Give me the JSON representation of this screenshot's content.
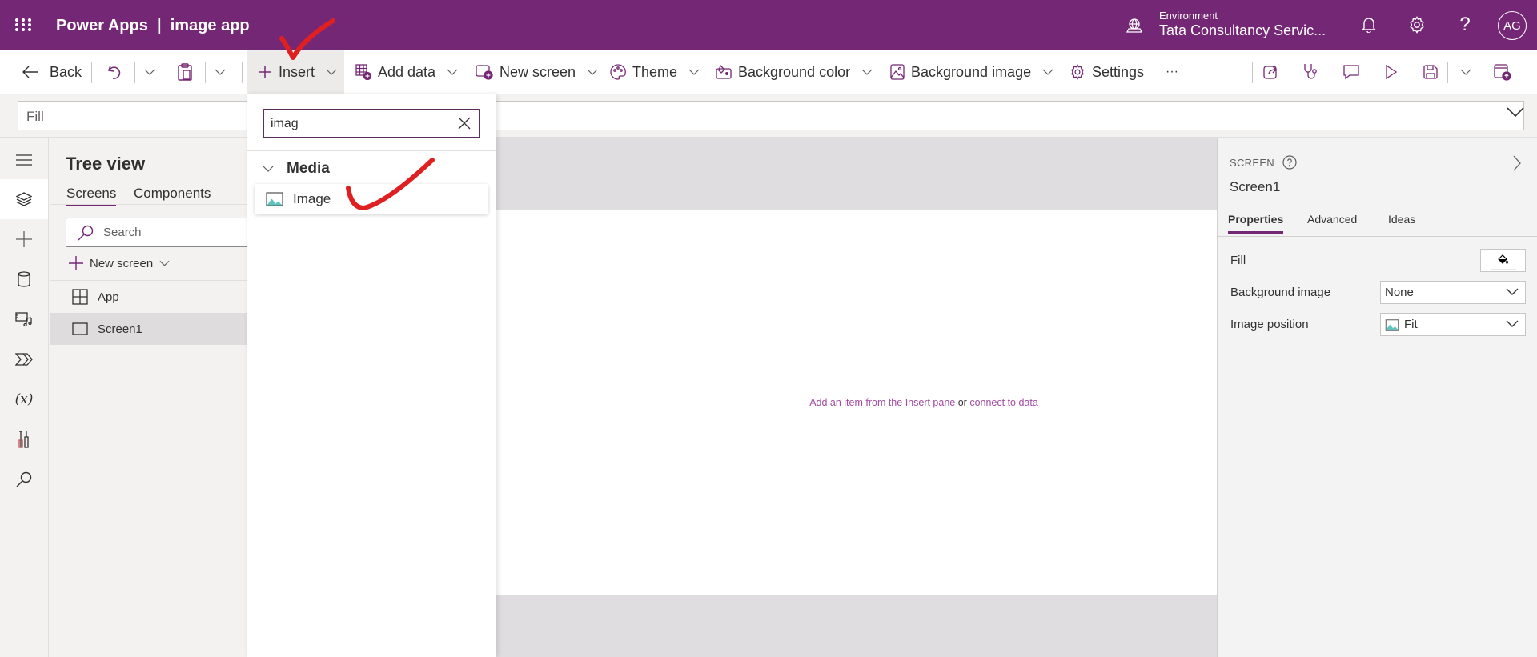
{
  "header": {
    "app_name": "Power Apps",
    "separator": "|",
    "app_title": "image app",
    "environment_label": "Environment",
    "environment_name": "Tata Consultancy Servic...",
    "avatar_initials": "AG",
    "icons": [
      "waffle-icon",
      "environment-icon",
      "bell-icon",
      "settings-icon",
      "help-icon"
    ]
  },
  "command_bar": {
    "back": "Back",
    "insert": "Insert",
    "add_data": "Add data",
    "new_screen": "New screen",
    "theme": "Theme",
    "background_color": "Background color",
    "background_image": "Background image",
    "settings": "Settings",
    "more": "···",
    "right_icons": [
      "share-icon",
      "app-checker-icon",
      "comments-icon",
      "preview-play-icon",
      "save-icon",
      "publish-icon"
    ]
  },
  "formula_bar": {
    "property": "Fill",
    "formula": ""
  },
  "tree_view": {
    "title": "Tree view",
    "tabs": [
      {
        "label": "Screens",
        "active": true
      },
      {
        "label": "Components",
        "active": false
      }
    ],
    "search_placeholder": "Search",
    "new_screen": "New screen",
    "nodes": [
      {
        "label": "App",
        "selected": false
      },
      {
        "label": "Screen1",
        "selected": true
      }
    ]
  },
  "insert_pane": {
    "search_value": "imag",
    "category": "Media",
    "items": [
      {
        "label": "Image",
        "icon": "image-icon"
      }
    ]
  },
  "canvas": {
    "hint_prefix": "Add an item from the Insert pane",
    "hint_or": "or",
    "hint_link": "connect to data"
  },
  "properties_panel": {
    "type": "SCREEN",
    "name": "Screen1",
    "tabs": [
      {
        "label": "Properties",
        "active": true
      },
      {
        "label": "Advanced",
        "active": false
      },
      {
        "label": "Ideas",
        "active": false
      }
    ],
    "fill_label": "Fill",
    "background_image_label": "Background image",
    "background_image_value": "None",
    "image_position_label": "Image position",
    "image_position_value": "Fit"
  },
  "colors": {
    "brand": "#742774",
    "annotation": "#e02020",
    "hint_text": "#a14ba1"
  }
}
